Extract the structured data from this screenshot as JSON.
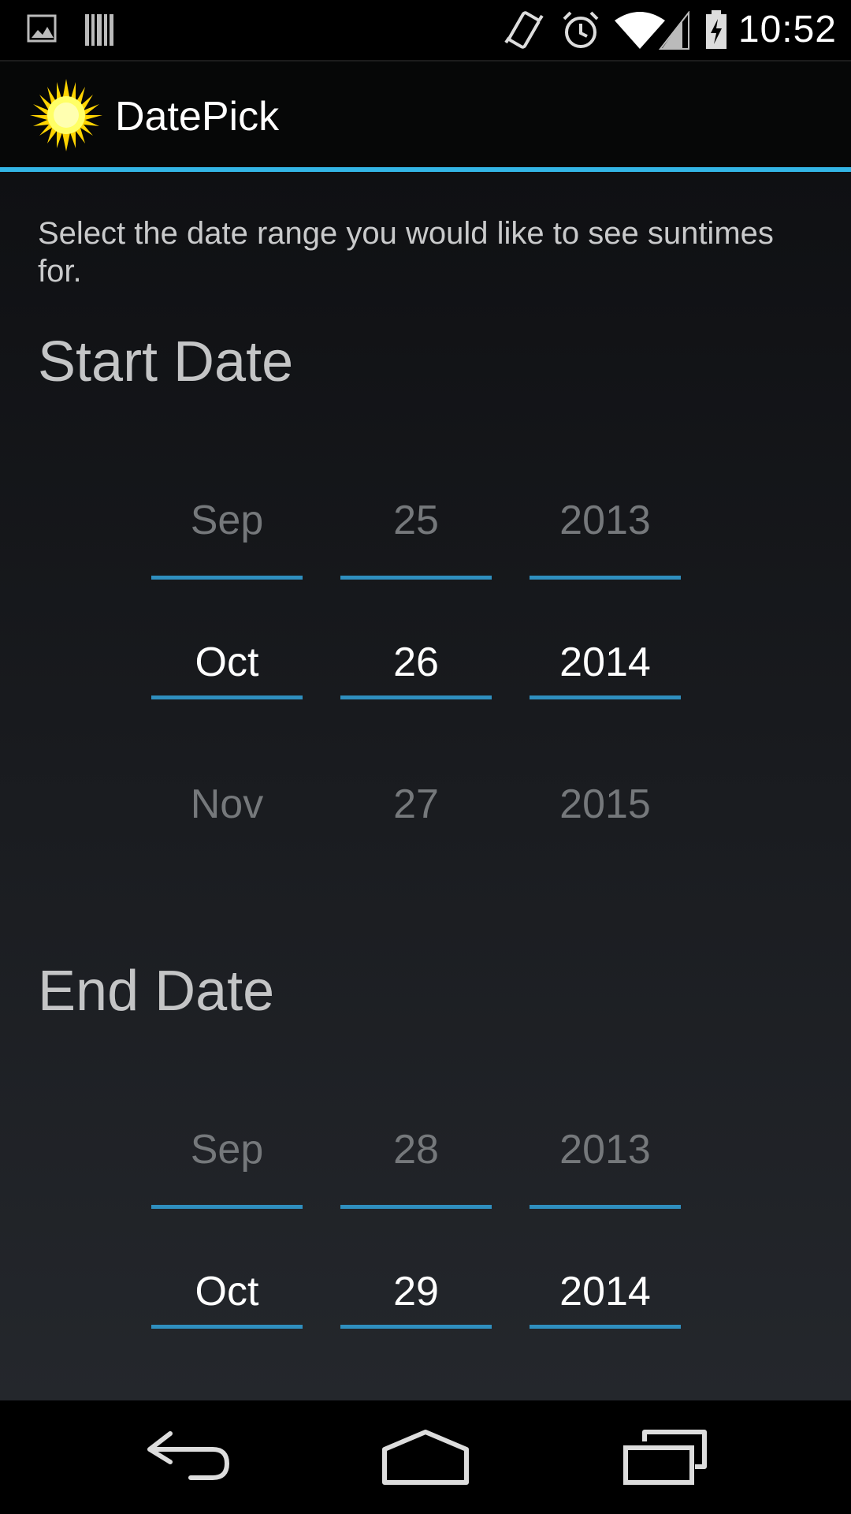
{
  "status_bar": {
    "time": "10:52",
    "icons": [
      "picture-icon",
      "barcode-icon",
      "vibrate-icon",
      "alarm-icon",
      "wifi-icon",
      "signal-icon",
      "battery-charging-icon"
    ]
  },
  "action_bar": {
    "title": "DatePick",
    "logo_icon": "sun-icon",
    "accent_color": "#33b5e5"
  },
  "intro_text": "Select the date range you would like to see suntimes for.",
  "start_date": {
    "title": "Start Date",
    "month": {
      "prev": "Sep",
      "current": "Oct",
      "next": "Nov"
    },
    "day": {
      "prev": "25",
      "current": "26",
      "next": "27"
    },
    "year": {
      "prev": "2013",
      "current": "2014",
      "next": "2015"
    }
  },
  "end_date": {
    "title": "End Date",
    "month": {
      "prev": "Sep",
      "current": "Oct"
    },
    "day": {
      "prev": "28",
      "current": "29"
    },
    "year": {
      "prev": "2013",
      "current": "2014"
    }
  },
  "nav_bar": {
    "icons": [
      "back-icon",
      "home-icon",
      "recent-apps-icon"
    ]
  }
}
